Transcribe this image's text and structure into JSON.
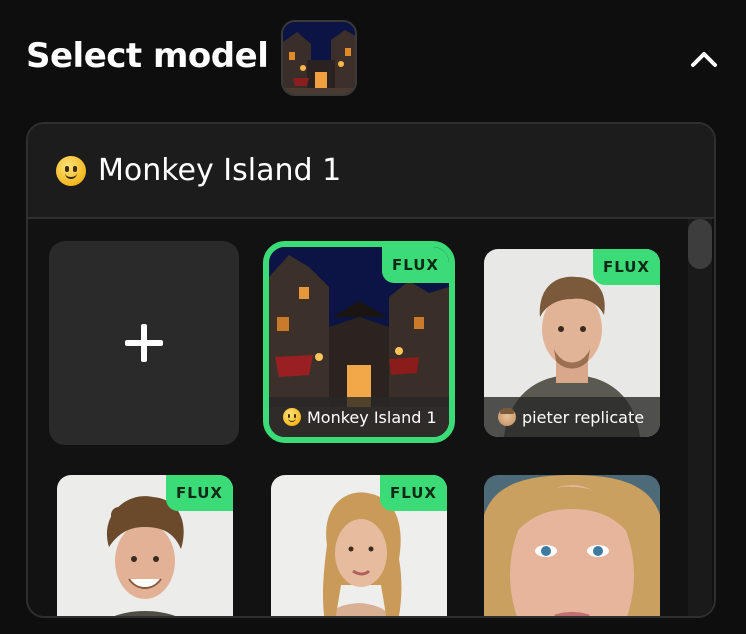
{
  "header": {
    "title": "Select model",
    "thumbnail_icon": "monkey-island-thumbnail",
    "collapse_icon": "chevron-up-icon"
  },
  "panel": {
    "selected_model": "Monkey Island 1",
    "selected_emoji": "slightly-smiling-face"
  },
  "models": [
    {
      "name": "add",
      "label": "+"
    },
    {
      "name": "Monkey Island 1",
      "badge": "FLUX",
      "emoji": "slightly-smiling-face",
      "selected": true
    },
    {
      "name": "pieter replicate",
      "badge": "FLUX",
      "emoji": "face-man"
    },
    {
      "name": "",
      "badge": "FLUX"
    },
    {
      "name": "",
      "badge": "FLUX"
    },
    {
      "name": ""
    }
  ],
  "colors": {
    "background": "#0e0e0e",
    "accent": "#3bdc78",
    "panel": "#121212",
    "panel_header": "#1c1c1c"
  }
}
